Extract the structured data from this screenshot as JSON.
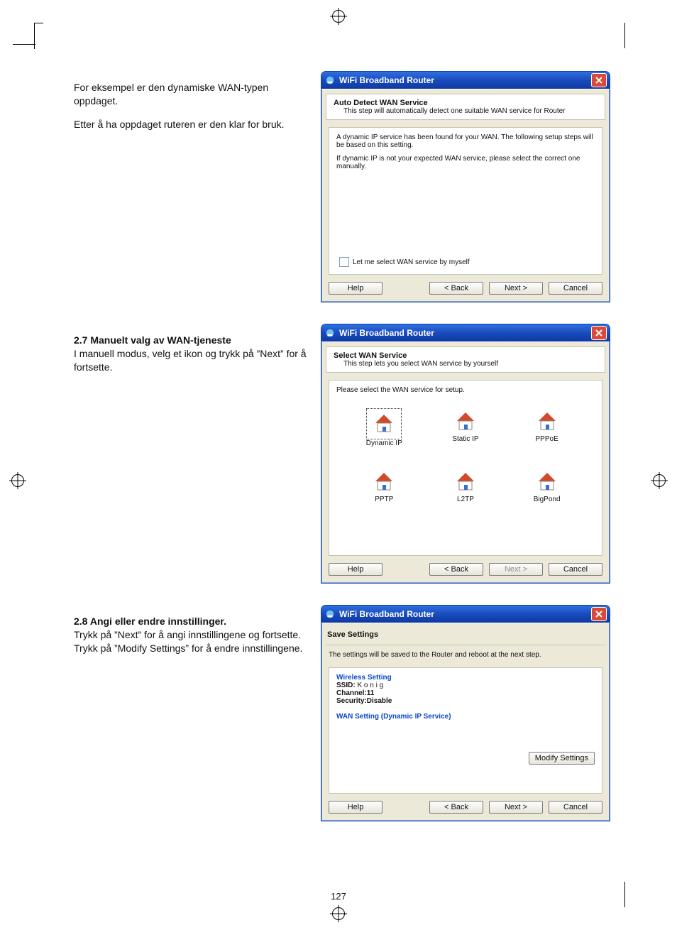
{
  "page_number": "127",
  "left": {
    "para1": "For eksempel er den dynamiske WAN-typen oppdaget.",
    "para2": "Etter å ha oppdaget ruteren er den klar for bruk.",
    "sec27_title": "2.7 Manuelt valg av WAN-tjeneste",
    "sec27_body": "I manuell modus, velg et ikon og trykk på ”Next” for å fortsette.",
    "sec28_title": "2.8 Angi eller endre innstillinger.",
    "sec28_body": "Trykk på ”Next” for å angi innstillingene og fortsette. Trykk på ”Modify Settings” for å endre innstillingene."
  },
  "win_common": {
    "title": "WiFi Broadband Router",
    "btn_help": "Help",
    "btn_back": "< Back",
    "btn_next": "Next >",
    "btn_cancel": "Cancel"
  },
  "win1": {
    "banner_title": "Auto Detect WAN Service",
    "banner_sub": "This step will automatically detect one suitable WAN service for Router",
    "body1": "A dynamic IP service has been found for your WAN. The following setup steps will be based on this setting.",
    "body2": "If dynamic IP is not your expected WAN service, please select the correct one manually.",
    "chk_label": "Let me select WAN service by myself"
  },
  "win2": {
    "banner_title": "Select WAN Service",
    "banner_sub": "This step lets you select WAN service by yourself",
    "intro": "Please select the WAN service for setup.",
    "opts": [
      "Dynamic IP",
      "Static IP",
      "PPPoE",
      "PPTP",
      "L2TP",
      "BigPond"
    ]
  },
  "win3": {
    "banner_title": "Save Settings",
    "intro": "The settings will be saved to the Router and reboot at the next step.",
    "wset_title": "Wireless Setting",
    "ssid_label": "SSID:",
    "ssid_val": " K o n i g",
    "channel": "Channel:11",
    "security": "Security:Disable",
    "wan_title": "WAN Setting  (Dynamic IP Service)",
    "modify": "Modify Settings"
  }
}
